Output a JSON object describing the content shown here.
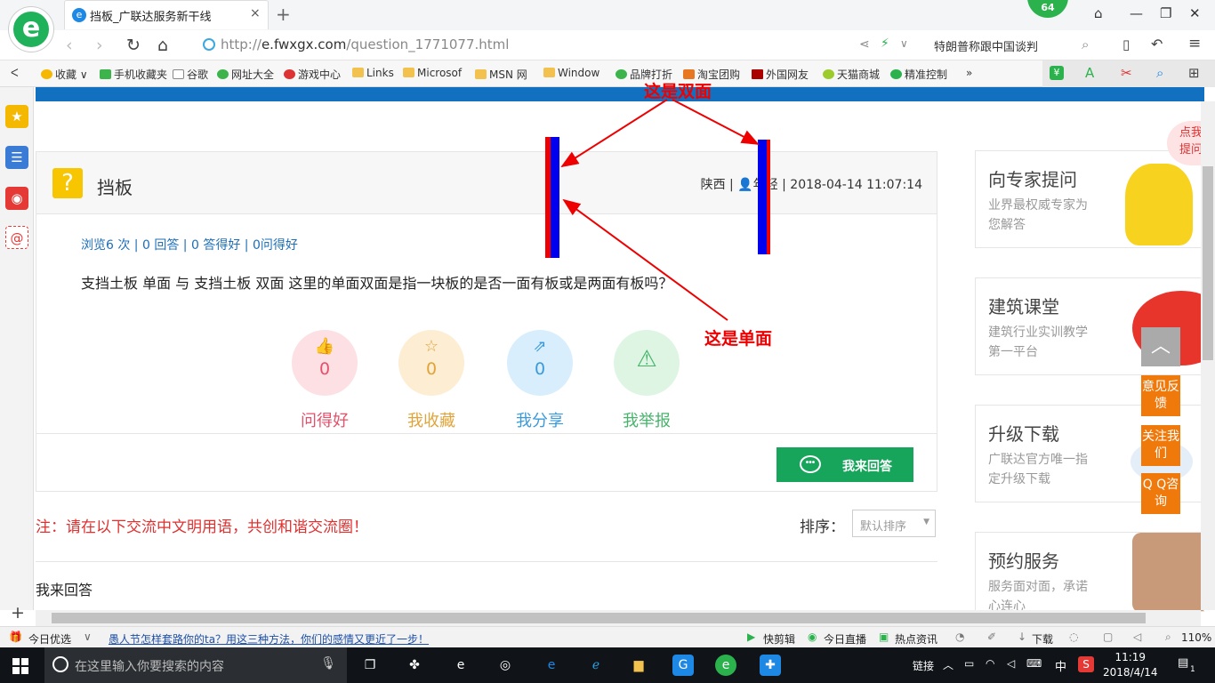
{
  "browser": {
    "tab_title": "挡板_广联达服务新干线",
    "tab_close": "×",
    "new_tab": "+",
    "badge_count": "64",
    "url_prefix": "http://",
    "url_host": "e.fwxgx.com",
    "url_path": "/question_1771077.html",
    "news_ticker": "特朗普称跟中国谈判",
    "favorites": [
      "收藏",
      "手机收藏夹",
      "谷歌",
      "网址大全",
      "游戏中心",
      "Links",
      "Microsof",
      "MSN 网",
      "Window",
      "品牌打折",
      "淘宝团购",
      "外国网友",
      "天猫商城",
      "精准控制"
    ],
    "favorites_more": "»"
  },
  "question": {
    "title": "挡板",
    "region": "陕西",
    "user": "年轻",
    "datetime": "2018-04-14 11:07:14",
    "views": "浏览6 次",
    "answers": "0 回答",
    "good_answers": "0 答得好",
    "asked_good": "0问得好",
    "body": "支挡土板 单面 与 支挡土板 双面 这里的单面双面是指一块板的是否一面有板或是两面有板吗？",
    "actions": [
      {
        "label": "问得好",
        "count": "0",
        "color": "#e5506a",
        "bg": "#fde0e4"
      },
      {
        "label": "我收藏",
        "count": "0",
        "color": "#e0a43a",
        "bg": "#fdedd2"
      },
      {
        "label": "我分享",
        "count": "0",
        "color": "#3b9ad9",
        "bg": "#d8eefc"
      },
      {
        "label": "我举报",
        "count": "",
        "color": "#48b36b",
        "bg": "#def5e4"
      }
    ],
    "answer_button": "我来回答"
  },
  "comments": {
    "notice": "注：请在以下交流中文明用语，共创和谐交流圈！",
    "sort_label": "排序：",
    "sort_value": "默认排序",
    "my_answer": "我来回答"
  },
  "sidebar_cards": [
    {
      "title": "向专家提问",
      "subtitle": "业界最权威专家为您解答"
    },
    {
      "title": "建筑课堂",
      "subtitle": "建筑行业实训教学第一平台"
    },
    {
      "title": "升级下载",
      "subtitle": "广联达官方唯一指定升级下载"
    },
    {
      "title": "预约服务",
      "subtitle": "服务面对面，承诺心连心"
    }
  ],
  "floating": {
    "corner_tag_1": "点我",
    "corner_tag_2": "提问",
    "feedback": "意见反馈",
    "follow": "关注我们",
    "qq": "Q Q咨询"
  },
  "annotations": {
    "double_label": "这是双面",
    "single_label": "这是单面"
  },
  "statusbar": {
    "today": "今日优选",
    "headline": "愚人节怎样套路你的ta？用这三种方法，你们的感情又更近了一步！",
    "quick_edit": "快剪辑",
    "live": "今日直播",
    "hot": "热点资讯",
    "download": "下载",
    "zoom": "110%"
  },
  "taskbar": {
    "search_placeholder": "在这里输入你要搜索的内容",
    "link_label": "链接",
    "ime": "中",
    "time": "11:19",
    "date": "2018/4/14",
    "notifications": "1"
  }
}
